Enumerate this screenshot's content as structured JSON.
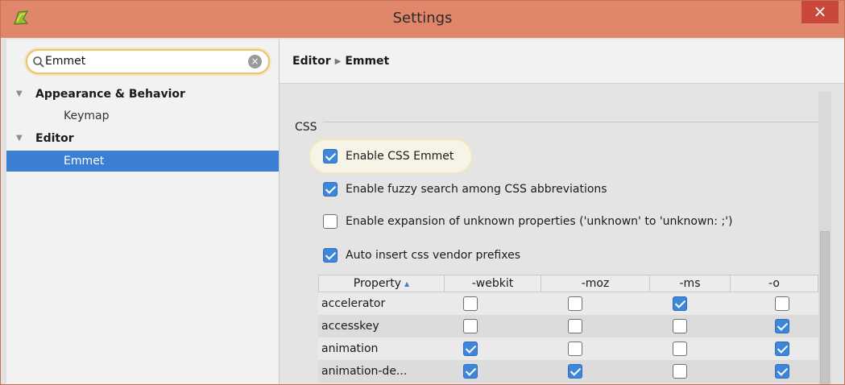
{
  "window": {
    "title": "Settings",
    "close_label": "×"
  },
  "sidebar": {
    "search": {
      "value": "Emmet",
      "clear_label": "×"
    },
    "tree": [
      {
        "label": "Appearance & Behavior",
        "kind": "group",
        "expanded": true
      },
      {
        "label": "Keymap",
        "kind": "child"
      },
      {
        "label": "Editor",
        "kind": "group",
        "expanded": true
      },
      {
        "label": "Emmet",
        "kind": "child",
        "selected": true
      }
    ]
  },
  "main": {
    "breadcrumb": {
      "parent": "Editor",
      "current": "Emmet"
    },
    "section_label": "CSS",
    "options": [
      {
        "label": "Enable CSS Emmet",
        "checked": true
      },
      {
        "label": "Enable fuzzy search among CSS abbreviations",
        "checked": true
      },
      {
        "label": "Enable expansion of unknown properties ('unknown' to 'unknown: ;')",
        "checked": false
      },
      {
        "label": "Auto insert css vendor prefixes",
        "checked": true
      }
    ],
    "table": {
      "columns": [
        "Property",
        "-webkit",
        "-moz",
        "-ms",
        "-o"
      ],
      "sort_column": "Property",
      "sort_indicator": "▲",
      "rows": [
        {
          "property": "accelerator",
          "webkit": false,
          "moz": false,
          "ms": true,
          "o": false
        },
        {
          "property": "accesskey",
          "webkit": false,
          "moz": false,
          "ms": false,
          "o": true
        },
        {
          "property": "animation",
          "webkit": true,
          "moz": false,
          "ms": false,
          "o": true
        },
        {
          "property": "animation-de...",
          "webkit": true,
          "moz": true,
          "ms": false,
          "o": true
        }
      ]
    }
  },
  "colors": {
    "titlebar": "#e0866a",
    "close_button": "#c9483b",
    "selection": "#3a7fd3",
    "checkbox_checked": "#3e86d9",
    "search_focus": "#e8c476"
  }
}
